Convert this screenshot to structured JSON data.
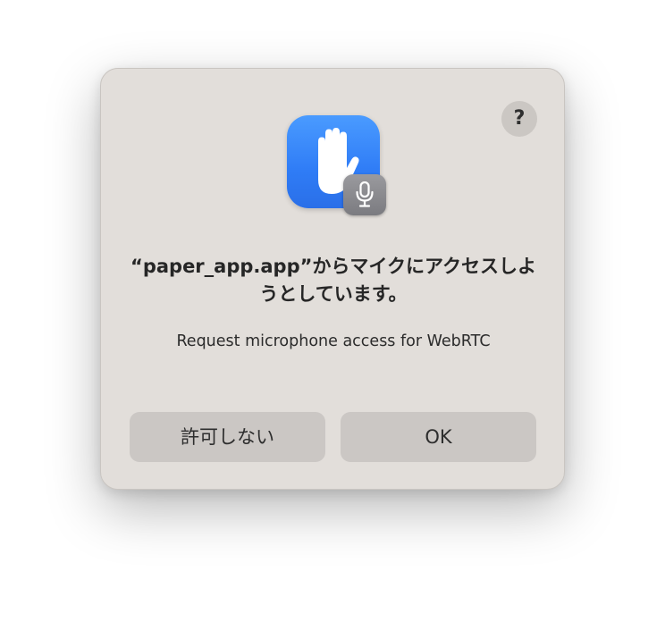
{
  "dialog": {
    "help_label": "?",
    "title": "“paper_app.app”からマイクにアクセスしようとしています。",
    "message": "Request microphone access for WebRTC",
    "buttons": {
      "deny_label": "許可しない",
      "ok_label": "OK"
    },
    "icons": {
      "app": "raised-hand-icon",
      "badge": "microphone-icon"
    }
  },
  "colors": {
    "dialog_background": "#e2deda",
    "button_background": "#cbc7c4",
    "app_icon_blue": "#2f7cf6",
    "badge_gray": "#86868b"
  }
}
